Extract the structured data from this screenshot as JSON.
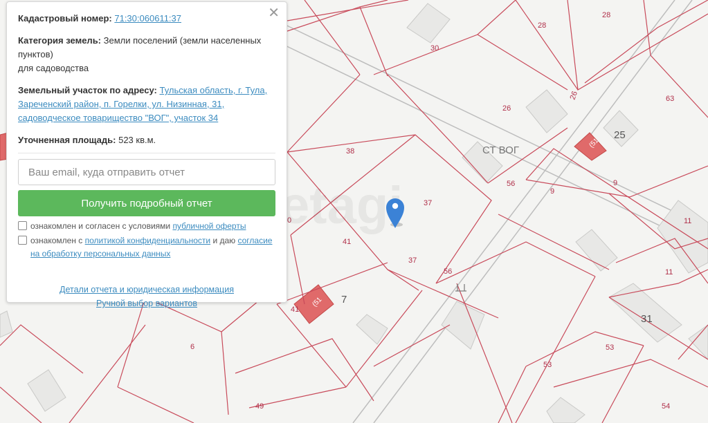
{
  "map": {
    "parcel_labels": [
      "28",
      "28",
      "30",
      "26",
      "26",
      "63",
      "25",
      "38",
      "37",
      "37",
      "41",
      "56",
      "56",
      "9",
      "9",
      "11",
      "11",
      "7",
      "41",
      "6",
      "53",
      "53",
      "31",
      "49",
      "54",
      "0"
    ],
    "house_numbers": [
      "25",
      "7",
      "31"
    ],
    "street_label": "СТ ВОГ",
    "badge_label": "(51",
    "watermark": "etagi",
    "colors": {
      "parcel_line": "#c84a5a",
      "road_line": "#b9b9b9",
      "building": "#e6e6e4",
      "marker": "#3b82d6"
    }
  },
  "panel": {
    "close_label": "✕",
    "cadastral_label": "Кадастровый номер:",
    "cadastral_value": "71:30:060611:37",
    "category_label": "Категория земель:",
    "category_value": " Земли поселений (земли населенных пунктов)",
    "category_use": "для садоводства",
    "address_label": "Земельный участок по адресу:",
    "address_value": "Тульская область, г. Тула, Зареченский район, п. Горелки, ул. Низинная, 31, садоводческое товарищество \"ВОГ\", участок 34",
    "area_label": "Уточненная площадь:",
    "area_value": " 523 кв.м.",
    "email_placeholder": "Ваш email, куда отправить отчет",
    "report_button": "Получить подробный отчет",
    "agree1_text": "ознакомлен и согласен с условиями ",
    "agree1_link": "публичной оферты",
    "agree2_text": "ознакомлен с ",
    "agree2_link1": "политикой конфиденциальности",
    "agree2_mid": " и даю ",
    "agree2_link2": "согласие на обработку персональных данных",
    "details_link": "Детали отчета и юридическая информация",
    "manual_link": "Ручной выбор вариантов"
  }
}
